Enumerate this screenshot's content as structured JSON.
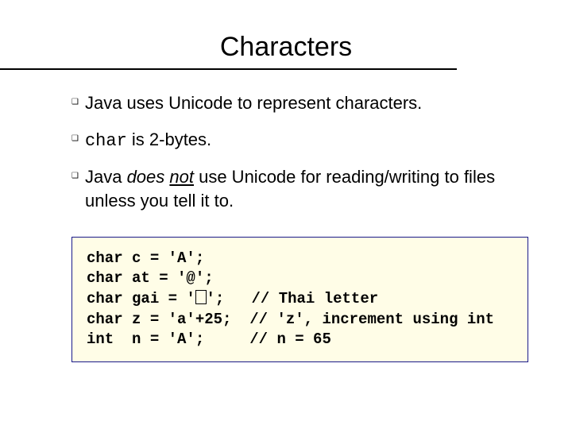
{
  "title": "Characters",
  "bullets": {
    "b1": "Java uses Unicode to represent characters.",
    "b2_code": "char",
    "b2_rest": " is 2-bytes.",
    "b3_a": "Java ",
    "b3_b": "does ",
    "b3_c": "not",
    "b3_d": " use Unicode for reading/writing to files unless you tell it to."
  },
  "code": {
    "l1": "char c = 'A';",
    "l2": "char at = '@';",
    "l3a": "char gai = '",
    "l3b": "';   // Thai letter",
    "l4": "char z = 'a'+25;  // 'z', increment using int",
    "l5": "int  n = 'A';     // n = 65"
  }
}
